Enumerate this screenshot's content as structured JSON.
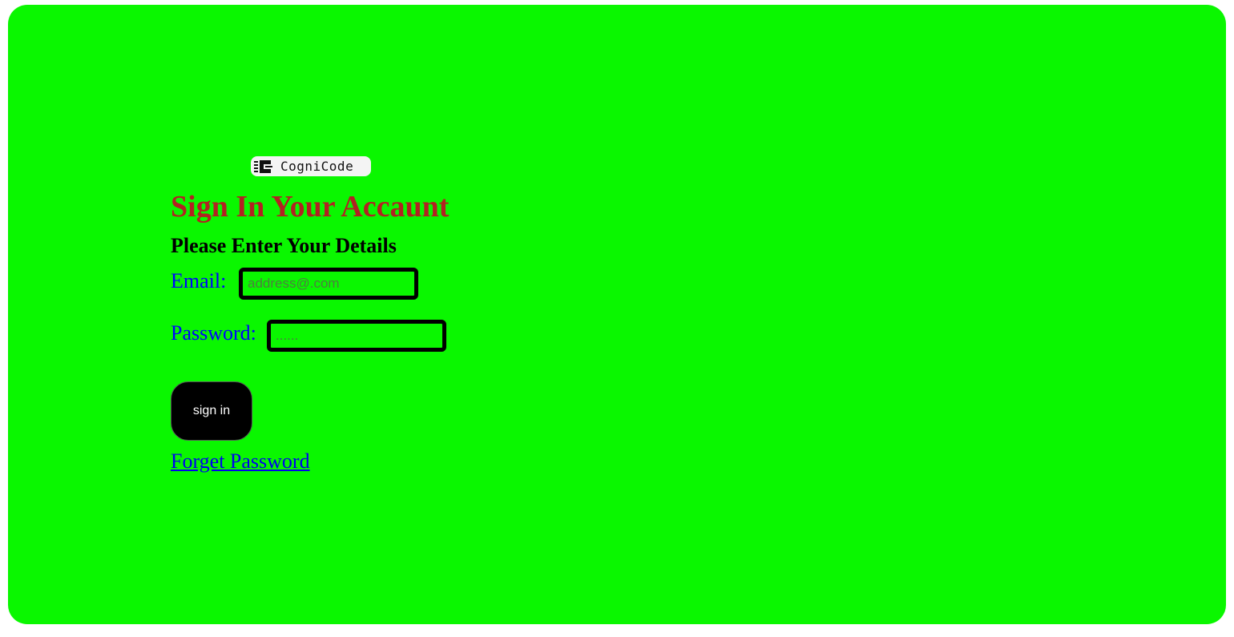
{
  "logo": {
    "text": "CogniCode",
    "icon": "cognicode-logo-icon"
  },
  "heading": {
    "title": "Sign In Your Accaunt",
    "subtitle": "Please Enter Your Details"
  },
  "form": {
    "email": {
      "label": "Email:",
      "value": "",
      "placeholder": "address@.com"
    },
    "password": {
      "label": "Password:",
      "value": "",
      "placeholder": "......"
    },
    "submit_label": "sign in",
    "forgot_label": "Forget Password"
  },
  "colors": {
    "background": "#0af700",
    "title": "#b22222",
    "label": "#0000ff",
    "link": "#0000ee",
    "button": "#000000",
    "input_border": "#000000"
  }
}
